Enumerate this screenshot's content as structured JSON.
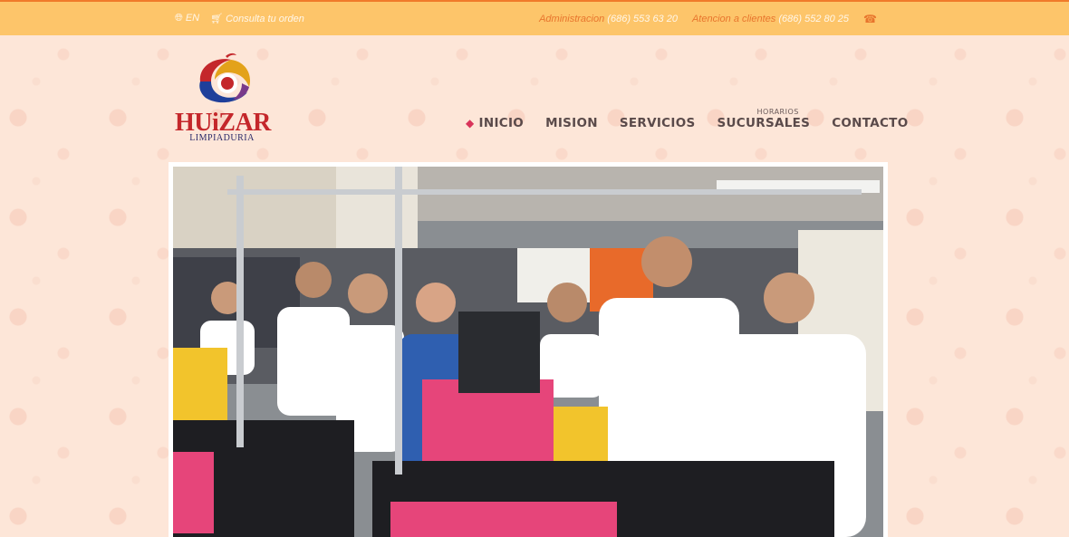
{
  "topbar": {
    "lang_label": "EN",
    "order_label": "Consulta tu orden",
    "admin_label": "Administracion",
    "admin_phone": "(686) 553 63 20",
    "support_label": "Atencion a clientes",
    "support_phone": "(686) 552 80 25",
    "icons": [
      "globe-icon",
      "cart-icon",
      "phone-icon"
    ]
  },
  "logo": {
    "name": "HUiZAR",
    "subtitle": "LIMPIADURIA"
  },
  "nav": {
    "items": [
      {
        "label": "INICIO",
        "icon": "tag-icon",
        "active": true
      },
      {
        "label": "MISION"
      },
      {
        "label": "SERVICIOS"
      },
      {
        "label": "SUCURSALES",
        "sup": "HORARIOS"
      },
      {
        "label": "CONTACTO"
      }
    ]
  },
  "hero": {
    "subject": "Huizar staff at the dry-cleaning counter"
  },
  "colors": {
    "topbar_bg": "#fdc56a",
    "topbar_accent": "#f07a2a",
    "page_bg": "#fde6d8",
    "brand_red": "#c4272b",
    "nav_text": "#5a4a4a",
    "active_icon": "#d9345a"
  }
}
